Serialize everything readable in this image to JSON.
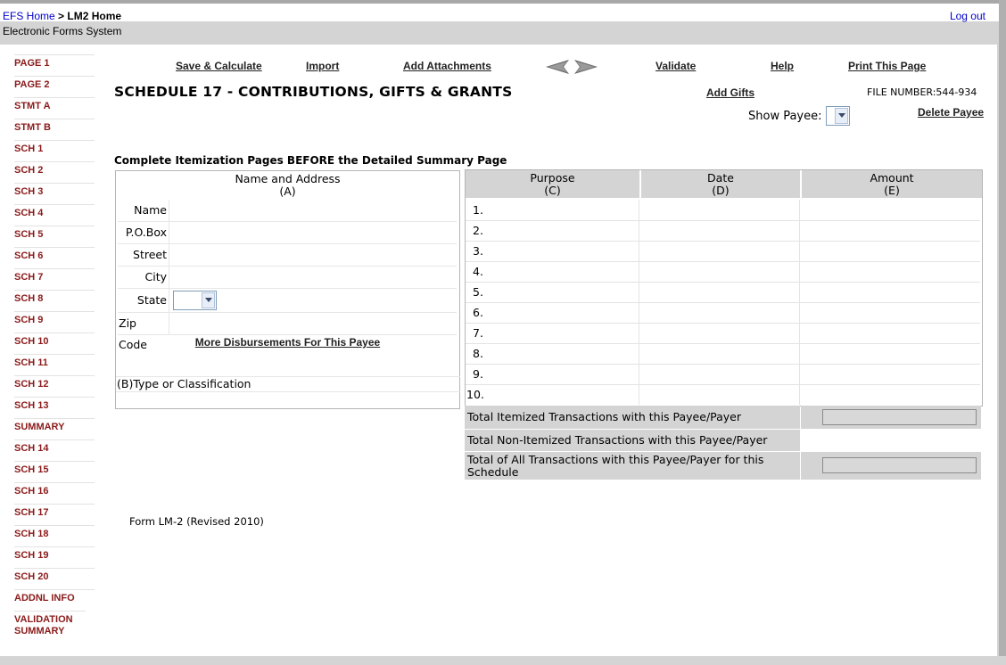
{
  "header": {
    "breadcrumb_home": "EFS Home",
    "breadcrumb_sep": " > ",
    "breadcrumb_current": "LM2 Home",
    "logout": "Log out",
    "system_title": "Electronic Forms System"
  },
  "sidebar": {
    "items": [
      "PAGE 1",
      "PAGE 2",
      "STMT A",
      "STMT B",
      "SCH 1",
      "SCH 2",
      "SCH 3",
      "SCH 4",
      "SCH 5",
      "SCH 6",
      "SCH 7",
      "SCH 8",
      "SCH 9",
      "SCH 10",
      "SCH 11",
      "SCH 12",
      "SCH 13",
      "SUMMARY",
      "SCH 14",
      "SCH 15",
      "SCH 16",
      "SCH 17",
      "SCH 18",
      "SCH 19",
      "SCH 20",
      "ADDNL INFO",
      "VALIDATION SUMMARY"
    ]
  },
  "toolbar": {
    "save_calc": "Save & Calculate",
    "import": "Import",
    "add_attachments": "Add Attachments",
    "validate": "Validate",
    "help": "Help",
    "print": "Print This Page"
  },
  "page": {
    "title": "SCHEDULE 17 - CONTRIBUTIONS, GIFTS & GRANTS",
    "add_gifts": "Add Gifts",
    "file_number": "FILE NUMBER:544-934",
    "show_payee_label": "Show Payee:",
    "show_payee_value": "",
    "delete_payee": "Delete Payee",
    "instruction": "Complete Itemization Pages BEFORE the Detailed Summary Page"
  },
  "name_address": {
    "header_line1": "Name and Address",
    "header_line2": "(A)",
    "fields": [
      "Name",
      "P.O.Box",
      "Street",
      "City",
      "State",
      "Zip Code"
    ],
    "state_value": "",
    "more_disbursements": "More Disbursements For This Payee",
    "type_classification": "(B)Type or Classification"
  },
  "grid": {
    "columns": [
      {
        "label": "Purpose",
        "sub": "(C)"
      },
      {
        "label": "Date",
        "sub": "(D)"
      },
      {
        "label": "Amount",
        "sub": "(E)"
      }
    ],
    "rows": [
      "1.",
      "2.",
      "3.",
      "4.",
      "5.",
      "6.",
      "7.",
      "8.",
      "9.",
      "10."
    ]
  },
  "totals": {
    "itemized": "Total Itemized Transactions with this Payee/Payer",
    "non_itemized": "Total Non-Itemized Transactions with this Payee/Payer",
    "all": "Total of All Transactions with this Payee/Payer for this Schedule"
  },
  "footer": {
    "form_note": "Form LM-2 (Revised 2010)"
  },
  "colors": {
    "sidebar_link": "#8b1a1a",
    "header_link": "#0000cc",
    "gray_panel": "#d4d4d4"
  }
}
